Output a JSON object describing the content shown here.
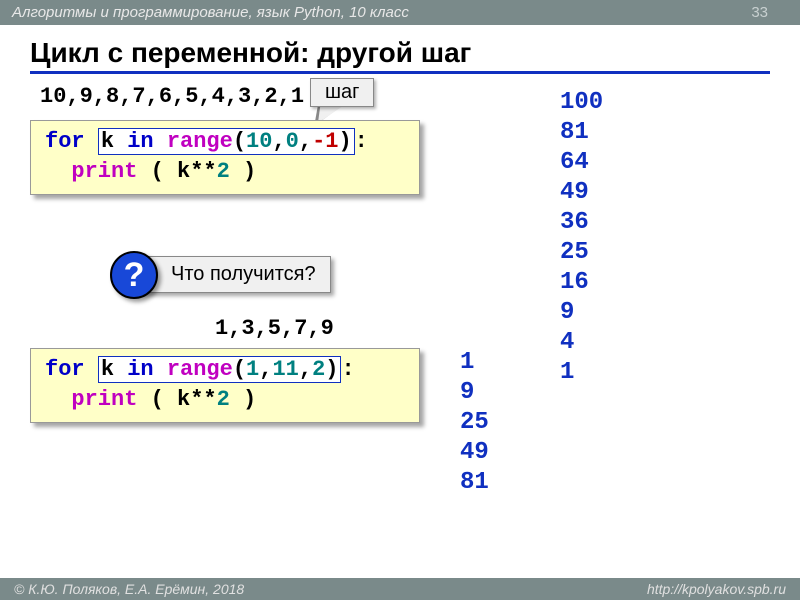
{
  "header": {
    "course": "Алгоритмы и программирование, язык Python, 10 класс",
    "page": "33"
  },
  "title": "Цикл с переменной: другой шаг",
  "seq1": "10,9,8,7,6,5,4,3,2,1",
  "step_label": "шаг",
  "code1": {
    "for": "for",
    "in": "in",
    "range": "range",
    "k": "k",
    "a": "10",
    "b": "0",
    "c": "-1",
    "print": "print",
    "expr_k": "k**",
    "expr_n": "2"
  },
  "question": {
    "mark": "?",
    "text": "Что получится?"
  },
  "seq2": "1,3,5,7,9",
  "code2": {
    "for": "for",
    "in": "in",
    "range": "range",
    "k": "k",
    "a": "1",
    "b": "11",
    "c": "2",
    "print": "print",
    "expr_k": "k**",
    "expr_n": "2"
  },
  "output1": "100\n81\n64\n49\n36\n25\n16\n9\n4\n1",
  "output2": "1\n9\n25\n49\n81",
  "footer": {
    "left": "© К.Ю. Поляков, Е.А. Ерёмин, 2018",
    "right": "http://kpolyakov.spb.ru"
  }
}
